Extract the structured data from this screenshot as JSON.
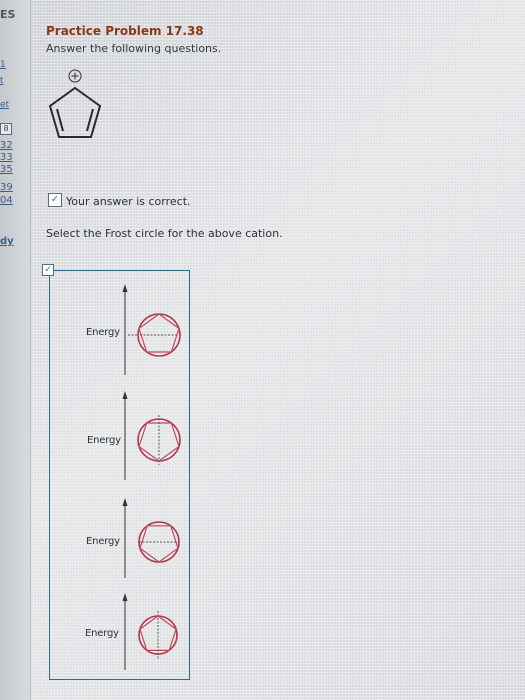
{
  "sidebar": {
    "header": "ES",
    "links": [
      "1",
      "t",
      "et"
    ],
    "box_label": "8",
    "numbers": [
      "32",
      "33",
      "35",
      "39",
      "04"
    ],
    "bottom": "dy"
  },
  "problem": {
    "title": "Practice Problem 17.38",
    "subtitle": "Answer the following questions."
  },
  "feedback": {
    "check_glyph": "✓",
    "text": "Your answer is correct."
  },
  "question": {
    "text": "Select the Frost circle for the above cation."
  },
  "choices": [
    {
      "energy_label": "Energy"
    },
    {
      "energy_label": "Energy"
    },
    {
      "energy_label": "Energy"
    },
    {
      "energy_label": "Energy"
    }
  ],
  "colors": {
    "title": "#8b3a12",
    "panel_border": "#2f6a86",
    "circle_stroke": "#b3364a",
    "check": "#2f8a3c"
  }
}
